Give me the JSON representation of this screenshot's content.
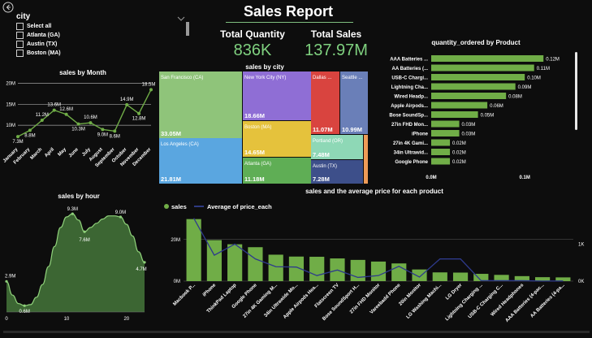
{
  "report": {
    "title": "Sales Report"
  },
  "slicer": {
    "title": "city",
    "items": [
      "Select all",
      "Atlanta (GA)",
      "Austin (TX)",
      "Boston (MA)"
    ]
  },
  "kpi": [
    {
      "label": "Total Quantity",
      "value": "836K"
    },
    {
      "label": "Total Sales",
      "value": "137.97M"
    }
  ],
  "colors": {
    "bg": "#0d0d0d",
    "green": "#70ad47",
    "kpi_value": "#7fd17f",
    "line": "#2e3a8c"
  },
  "icons": {
    "back": "back-arrow-icon",
    "chevron": "chevron-down-icon"
  },
  "chart_data": [
    {
      "id": "month",
      "type": "line",
      "title": "sales by Month",
      "categories": [
        "January",
        "February",
        "March",
        "April",
        "May",
        "June",
        "July",
        "August",
        "September",
        "October",
        "November",
        "December"
      ],
      "values": [
        7.3,
        8.8,
        11.2,
        13.6,
        12.6,
        10.3,
        10.6,
        9.0,
        8.6,
        14.9,
        12.8,
        18.5
      ],
      "data_labels": [
        "7.3M",
        "8.8M",
        "11.2M",
        "13.6M",
        "12.6M",
        "10.3M",
        "10.6M",
        "9.0M",
        "8.6M",
        "14.9M",
        "12.8M",
        "18.5M"
      ],
      "y_ticks": [
        "10M",
        "15M",
        "20M"
      ],
      "ylim": [
        5,
        20.5
      ]
    },
    {
      "id": "hour",
      "type": "area",
      "title": "sales by hour",
      "x": [
        0,
        1,
        2,
        3,
        4,
        5,
        6,
        7,
        8,
        9,
        10,
        11,
        12,
        13,
        14,
        15,
        16,
        17,
        18,
        19,
        20,
        21,
        22,
        23
      ],
      "values": [
        2.9,
        1.6,
        0.8,
        0.6,
        0.7,
        1.4,
        2.6,
        4.3,
        6.2,
        8.0,
        9.0,
        9.3,
        8.7,
        7.6,
        8.0,
        8.4,
        8.8,
        9.1,
        9.1,
        9.0,
        8.3,
        7.2,
        5.7,
        4.7
      ],
      "data_labels": {
        "0": "2.9M",
        "3": "0.6M",
        "11": "9.3M",
        "13": "7.6M",
        "19": "9.0M",
        "23": "4.7M"
      },
      "x_ticks": [
        0,
        10,
        20
      ],
      "ylim": [
        0,
        10
      ]
    },
    {
      "id": "city",
      "type": "treemap",
      "title": "sales by city",
      "items": [
        {
          "label": "San Francisco (CA)",
          "value": "33.05M",
          "color": "#8fc47a"
        },
        {
          "label": "Los Angeles (CA)",
          "value": "21.81M",
          "color": "#5aa6e0"
        },
        {
          "label": "New York City (NY)",
          "value": "18.66M",
          "color": "#8f6ed5"
        },
        {
          "label": "Boston (MA)",
          "value": "14.65M",
          "color": "#e5c23c"
        },
        {
          "label": "Atlanta (GA)",
          "value": "11.18M",
          "color": "#5fae55"
        },
        {
          "label": "Dallas ...",
          "value": "11.07M",
          "color": "#d9443f"
        },
        {
          "label": "Seattle ...",
          "value": "10.99M",
          "color": "#6a7fb8"
        },
        {
          "label": "Portland (OR)",
          "value": "7.48M",
          "color": "#8ed8b6"
        },
        {
          "label": "Austin (TX)",
          "value": "7.28M",
          "color": "#3d4f8a"
        },
        {
          "label": "",
          "value": "",
          "color": "#ee9b57"
        }
      ]
    },
    {
      "id": "qty",
      "type": "bar",
      "orientation": "horizontal",
      "title": "quantity_ordered by Product",
      "categories": [
        "AAA Batteries ...",
        "AA Batteries (...",
        "USB-C Chargi...",
        "Lightning Cha...",
        "Wired Headp...",
        "Apple Airpods...",
        "Bose SoundSp...",
        "27in FHD Mon...",
        "iPhone",
        "27in 4K Gami...",
        "34in Ultrawid...",
        "Google Phone"
      ],
      "values": [
        0.12,
        0.11,
        0.1,
        0.09,
        0.08,
        0.06,
        0.05,
        0.03,
        0.03,
        0.02,
        0.02,
        0.02
      ],
      "data_labels": [
        "0.12M",
        "0.11M",
        "0.10M",
        "0.09M",
        "0.08M",
        "0.06M",
        "0.05M",
        "0.03M",
        "0.03M",
        "0.02M",
        "0.02M",
        "0.02M"
      ],
      "x_ticks": [
        "0.0M",
        "0.1M"
      ],
      "xlim": [
        0,
        0.125
      ]
    },
    {
      "id": "combo",
      "type": "bar",
      "title": "sales and the average price for each product",
      "legend": [
        "sales",
        "Average of price_each"
      ],
      "categories": [
        "Macbook P...",
        "iPhone",
        "ThinkPad Laptop",
        "Google Phone",
        "27in 4K Gaming M...",
        "34in Ultrawide Mo...",
        "Apple Airpods Hea...",
        "Flatscreen TV",
        "Bose SoundSport H...",
        "27in FHD Monitor",
        "Vareebadd Phone",
        "20in Monitor",
        "LG Washing Machi...",
        "LG Dryer",
        "Lightning Charging ...",
        "USB-C Charging C...",
        "Wired Headphones",
        "AAA Batteries (4-pac...",
        "AA Batteries (4-pa..."
      ],
      "series": [
        {
          "name": "sales",
          "values": [
            29.8,
            19.7,
            17.7,
            16.3,
            12.7,
            11.8,
            11.7,
            10.9,
            10.2,
            9.4,
            8.5,
            5.6,
            4.2,
            4.1,
            3.5,
            3.0,
            2.4,
            1.9,
            1.8
          ]
        },
        {
          "name": "Average of price_each",
          "values": [
            1700,
            700,
            1000,
            600,
            390,
            380,
            150,
            300,
            100,
            150,
            400,
            110,
            600,
            600,
            15,
            12,
            12,
            3,
            4
          ]
        }
      ],
      "y_ticks": [
        "0M",
        "20M"
      ],
      "y2_ticks": [
        "0K",
        "1K"
      ],
      "ylim": [
        0,
        32
      ],
      "y2lim": [
        0,
        1800
      ]
    }
  ]
}
